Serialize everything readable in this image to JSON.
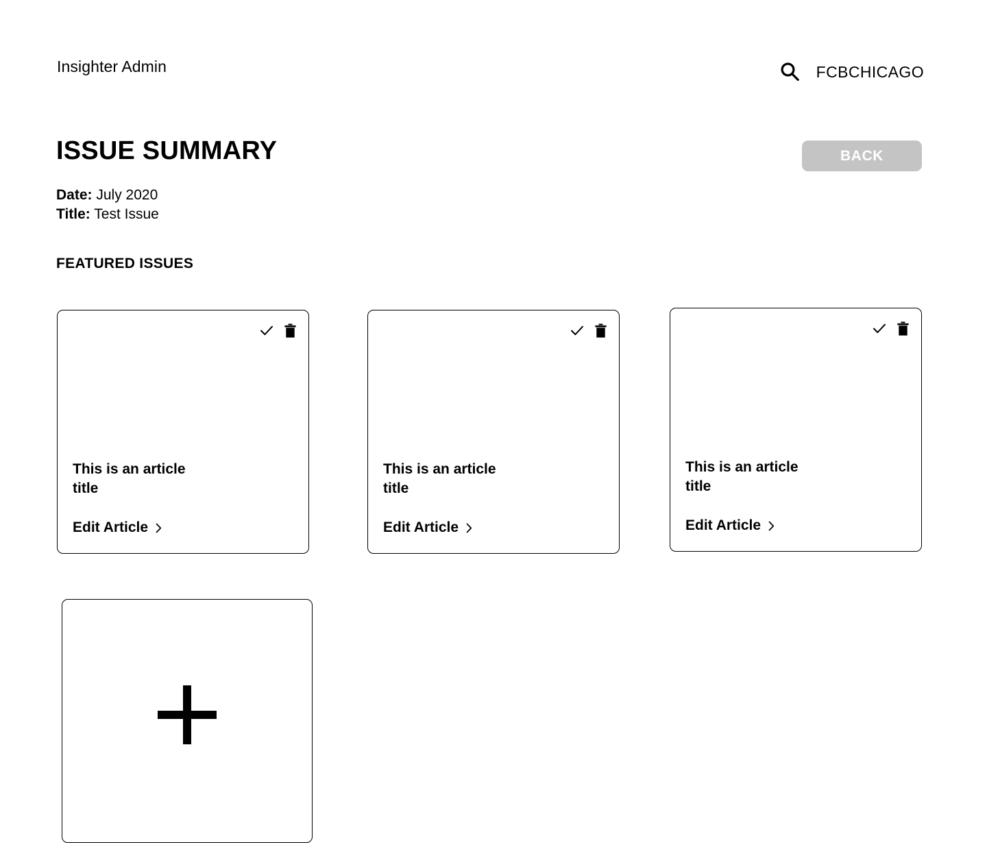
{
  "header": {
    "app_name": "Insighter Admin",
    "search_icon": "search-icon",
    "org_name": "FCBCHICAGO"
  },
  "page": {
    "title": "ISSUE SUMMARY",
    "back_label": "BACK"
  },
  "meta": {
    "date_label": "Date:",
    "date_value": "July 2020",
    "title_label": "Title:",
    "title_value": "Test Issue"
  },
  "section": {
    "heading": "FEATURED ISSUES"
  },
  "cards": [
    {
      "title": "This is an article title",
      "link_label": "Edit Article",
      "approve_icon": "check-icon",
      "delete_icon": "trash-icon",
      "chevron_icon": "chevron-right-icon"
    },
    {
      "title": "This is an article title",
      "link_label": "Edit Article",
      "approve_icon": "check-icon",
      "delete_icon": "trash-icon",
      "chevron_icon": "chevron-right-icon"
    },
    {
      "title": "This is an article title",
      "link_label": "Edit Article",
      "approve_icon": "check-icon",
      "delete_icon": "trash-icon",
      "chevron_icon": "chevron-right-icon"
    },
    {
      "add_icon": "plus-icon"
    }
  ],
  "colors": {
    "background": "#ffffff",
    "text": "#000000",
    "button_disabled": "#c4c4c4",
    "button_text": "#ffffff",
    "card_border": "#000000"
  }
}
